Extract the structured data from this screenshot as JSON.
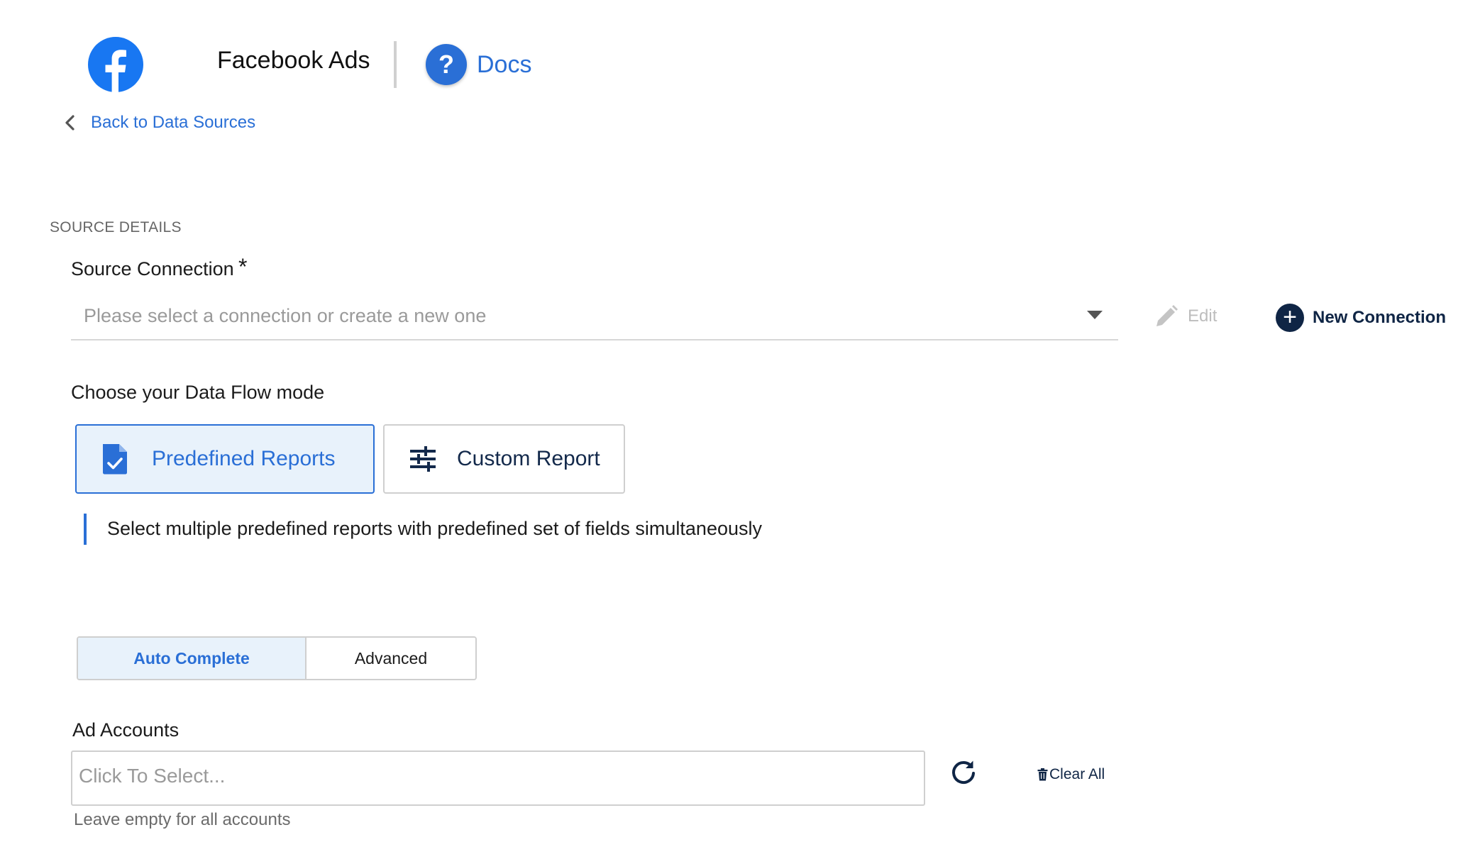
{
  "header": {
    "app_title": "Facebook Ads",
    "docs_label": "Docs",
    "docs_icon_glyph": "?"
  },
  "nav": {
    "back_label": "Back to Data Sources"
  },
  "source_details": {
    "section_title": "SOURCE DETAILS",
    "connection_label": "Source Connection",
    "required_marker": "*",
    "connection_placeholder": "Please select a connection or create a new one",
    "edit_label": "Edit",
    "new_connection_label": "New Connection",
    "new_connection_glyph": "+"
  },
  "flow_mode": {
    "label": "Choose your Data Flow mode",
    "options": [
      {
        "label": "Predefined Reports",
        "icon": "document-check-icon",
        "selected": true
      },
      {
        "label": "Custom Report",
        "icon": "sliders-icon",
        "selected": false
      }
    ],
    "hint": "Select multiple predefined reports with predefined set of fields simultaneously"
  },
  "toggle": {
    "auto_label": "Auto Complete",
    "advanced_label": "Advanced",
    "selected": "Auto Complete"
  },
  "ad_accounts": {
    "label": "Ad Accounts",
    "placeholder": "Click To Select...",
    "clear_label": "Clear All",
    "hint": "Leave empty for all accounts"
  },
  "colors": {
    "accent": "#2a6fd6",
    "navy": "#0f2545",
    "facebook_blue": "#1877f2",
    "selected_bg": "#e8f2fb"
  }
}
